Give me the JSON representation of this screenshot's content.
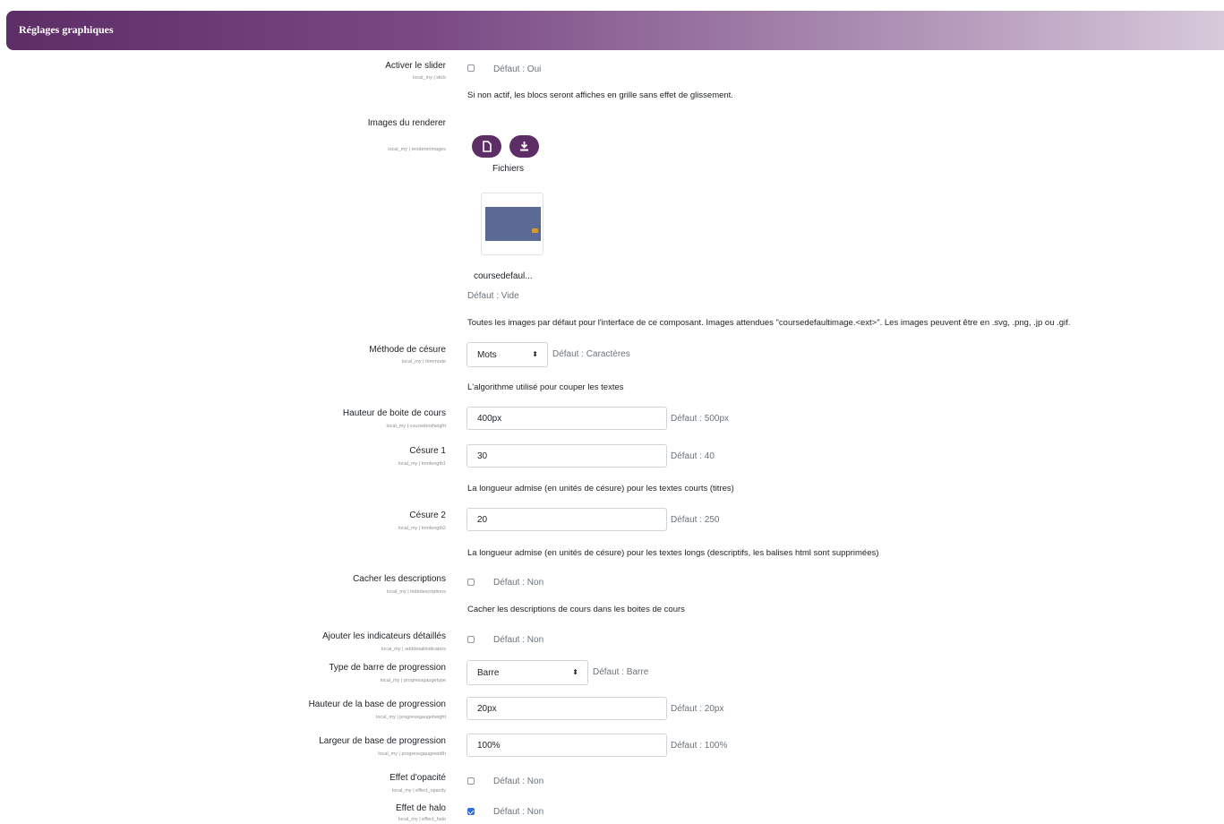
{
  "header": {
    "title": "Réglages graphiques"
  },
  "settings": {
    "slider": {
      "label": "Activer le slider",
      "key": "local_my | slick",
      "default": "Défaut : Oui",
      "checked": false,
      "description": "Si non actif, les blocs seront affiches en grille sans effet de glissement."
    },
    "renderer": {
      "label": "Images du renderer",
      "key": "local_my | rendererimages",
      "files_label": "Fichiers",
      "file_name": "coursedefaul...",
      "default": "Défaut : Vide",
      "description": "Toutes les images par défaut pour l'interface de ce composant. Images attendues \"coursedefaultimage.<ext>\". Les images peuvent être en .svg, .png, .jp ou .gif."
    },
    "trimmode": {
      "label": "Méthode de césure",
      "key": "local_my | trimmode",
      "value": "Mots",
      "default": "Défaut : Caractères",
      "description": "L'algorithme utilisé pour couper les textes"
    },
    "courseboxheight": {
      "label": "Hauteur de boite de cours",
      "key": "local_my | courseboxheight",
      "value": "400px",
      "default": "Défaut : 500px"
    },
    "trimlength1": {
      "label": "Césure 1",
      "key": "local_my | trimlength1",
      "value": "30",
      "default": "Défaut : 40",
      "description": "La longueur admise (en unités de césure) pour les textes courts (titres)"
    },
    "trimlength2": {
      "label": "Césure 2",
      "key": "local_my | trimlength2",
      "value": "20",
      "default": "Défaut : 250",
      "description": "La longueur admise (en unités de césure) pour les textes longs (descriptifs, les balises html sont supprimées)"
    },
    "hidedescriptions": {
      "label": "Cacher les descriptions",
      "key": "local_my | hidedescriptions",
      "default": "Défaut : Non",
      "checked": false,
      "description": "Cacher les descriptions de cours dans les boites de cours"
    },
    "adddetailindicators": {
      "label": "Ajouter les indicateurs détaillés",
      "key": "local_my | adddetailindicators",
      "default": "Défaut : Non",
      "checked": false
    },
    "progressgaugetype": {
      "label": "Type de barre de progression",
      "key": "local_my | progressgaugetype",
      "value": "Barre",
      "default": "Défaut : Barre"
    },
    "progressgaugeheight": {
      "label": "Hauteur de la base de progression",
      "key": "local_my | progressgaugeheight",
      "value": "20px",
      "default": "Défaut : 20px"
    },
    "progressgaugewidth": {
      "label": "Largeur de base de progression",
      "key": "local_my | progressgaugewidth",
      "value": "100%",
      "default": "Défaut : 100%"
    },
    "effect_opacity": {
      "label": "Effet d'opacité",
      "key": "local_my | effect_opacity",
      "default": "Défaut : Non",
      "checked": false
    },
    "effect_halo": {
      "label": "Effet de halo",
      "key": "local_my | effect_halo",
      "default": "Défaut : Non",
      "checked": true
    }
  },
  "colors": {
    "brand": "#5d2d66",
    "checkbox_checked": "#2f6edb"
  },
  "icons": {
    "file_picker": "file-icon",
    "download": "download-icon"
  }
}
